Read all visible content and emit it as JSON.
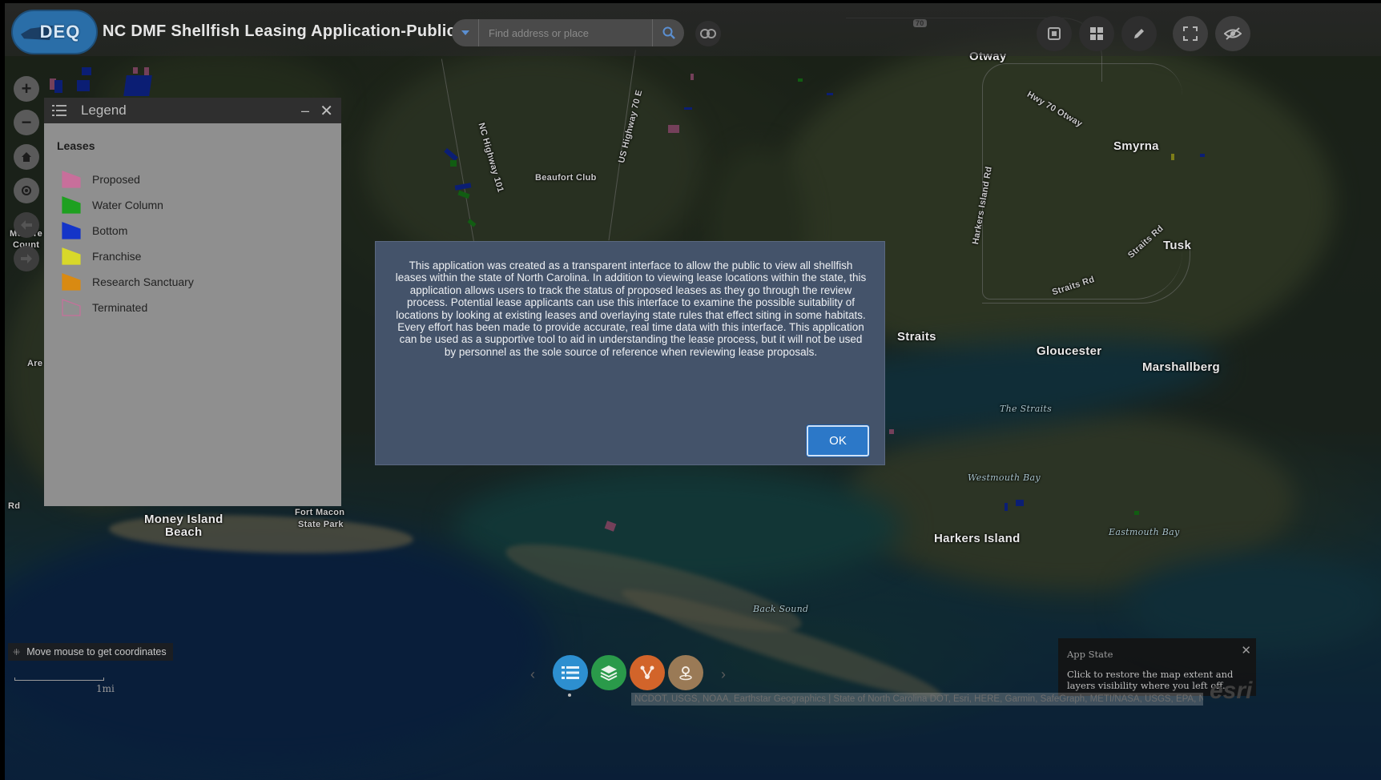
{
  "app": {
    "logo_text": "DEQ",
    "title": "NC DMF Shellfish Leasing Application-Public"
  },
  "search": {
    "placeholder": "Find address or place"
  },
  "top_toolbar": {
    "icons": [
      "link-icon",
      "print-icon",
      "basemap-gallery-icon",
      "draw-icon",
      "fullscreen-icon",
      "hide-icon"
    ]
  },
  "map_controls": {
    "icons": [
      "zoom-in",
      "zoom-out",
      "home",
      "locate",
      "previous-extent",
      "next-extent"
    ],
    "zoom_in": "+",
    "zoom_out": "−"
  },
  "legend": {
    "title": "Legend",
    "layer_title": "Leases",
    "items": [
      {
        "label": "Proposed",
        "color": "#c86f9b"
      },
      {
        "label": "Water Column",
        "color": "#1ea020"
      },
      {
        "label": "Bottom",
        "color": "#1435c8"
      },
      {
        "label": "Franchise",
        "color": "#d8d82a"
      },
      {
        "label": "Research Sanctuary",
        "color": "#d98a12"
      },
      {
        "label": "Terminated",
        "color": "#c86f9b"
      }
    ]
  },
  "map_labels": {
    "otway": "Otway",
    "hwy70": "Hwy 70 Otway",
    "smyrna": "Smyrna",
    "tusk": "Tusk",
    "straits_rd": "Straits Rd",
    "straits_rd2": "Straits Rd",
    "straits": "Straits",
    "gloucester": "Gloucester",
    "marshallberg": "Marshallberg",
    "the_straits": "The Straits",
    "westmouth_bay": "Westmouth Bay",
    "eastmouth_bay": "Eastmouth Bay",
    "harkers_island": "Harkers Island",
    "harkers_island_rd": "Harkers Island Rd",
    "back_sound": "Back Sound",
    "beaufort_club": "Beaufort Club",
    "nc_hwy_101": "NC Highway 101",
    "us_hwy_70e": "US Highway 70 E",
    "money_island_1": "Money Island",
    "money_island_2": "Beach",
    "fort_macon_1": "Fort Macon",
    "fort_macon_2": "State Park",
    "edge_are": "Are",
    "edge_rd": "Rd",
    "edge_mo": "Mo",
    "edge_me": "re",
    "edge_county": "Count",
    "route_70": "70"
  },
  "dialog": {
    "message": "This application was created as a transparent interface to allow the public to view all shellfish leases within the state of North Carolina. In addition to viewing lease locations within the state, this application allows users to track the status of proposed leases as they go through the review process. Potential lease applicants can use this interface to examine the possible suitability of locations by looking at existing leases and overlaying state rules that effect siting in some habitats. Every effort has been made to provide accurate, real time data with this interface. This application can be used as a supportive tool to aid in understanding the lease process, but it will not be used by personnel as the sole source of reference when reviewing lease proposals.",
    "ok_label": "OK"
  },
  "coordinates": {
    "text": "Move mouse to get coordinates"
  },
  "scale": {
    "label": "1mi"
  },
  "dock": {
    "buttons": [
      {
        "name": "legend",
        "color": "#2d8fd0"
      },
      {
        "name": "layer-list",
        "color": "#2a9a4a"
      },
      {
        "name": "share",
        "color": "#d2642a"
      },
      {
        "name": "geolocate",
        "color": "#9a7a56"
      }
    ]
  },
  "app_state": {
    "title": "App State",
    "message": "Click to restore the map extent and layers visibility where you left off."
  },
  "attribution": "NCDOT, USGS, NOAA, Earthstar Geographics | State of North Carolina DOT, Esri, HERE, Garmin, SafeGraph, METI/NASA, USGS, EPA, NPS, USDA",
  "esri_logo": "esri"
}
